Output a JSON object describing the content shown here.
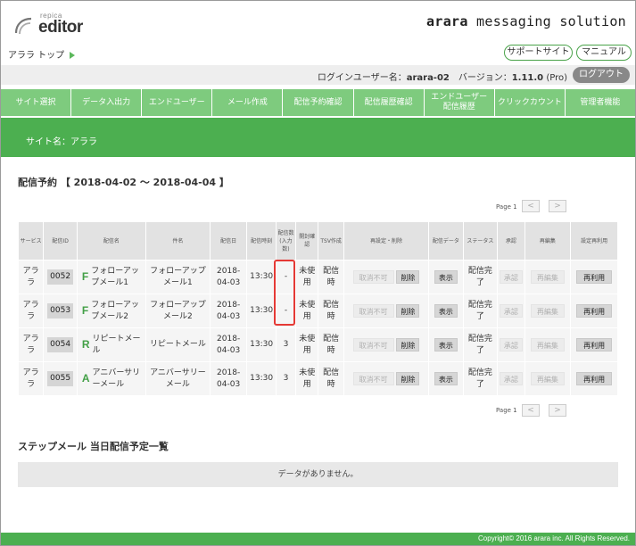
{
  "logo": {
    "small": "repica",
    "main": "editor"
  },
  "brand": {
    "left": "arara",
    "right": " messaging solution"
  },
  "breadcrumb": {
    "label": "アララ トップ"
  },
  "header_buttons": {
    "support": "サポートサイト",
    "manual": "マニュアル"
  },
  "userbar": {
    "user_label": "ログインユーザー名：",
    "user_name": "arara-02",
    "version_label": "　バージョン：",
    "version": "1.11.0",
    "edition": " (Pro)",
    "logout": "ログアウト"
  },
  "nav": {
    "items": [
      "サイト選択",
      "データ入出力",
      "エンドユーザー",
      "メール作成",
      "配信予約確認",
      "配信履歴確認",
      "エンドユーザー\n配信履歴",
      "クリックカウント",
      "管理者機能"
    ]
  },
  "site": {
    "label": "サイト名：アララ"
  },
  "schedule": {
    "title": "配信予約 【 2018-04-02 ～ 2018-04-04 】",
    "page_label": "Page 1",
    "prev": "<",
    "next": ">",
    "headers": [
      "サービス",
      "配信ID",
      "配信名",
      "件名",
      "配信日",
      "配信時刻",
      "配信数(入力数)",
      "開封確認",
      "TSV作成",
      "再設定・削除",
      "配信データ",
      "ステータス",
      "承認",
      "再編集",
      "設定再利用"
    ],
    "rows": [
      {
        "service": "アララ",
        "id": "0052",
        "letter": "F",
        "name": "フォローアップメール1",
        "subject": "フォローアップメール1",
        "date": "2018-04-03",
        "time": "13:30",
        "count": "-",
        "open": "未使用",
        "tsv": "配信時",
        "cancel": "取消不可",
        "delete": "削除",
        "show": "表示",
        "status": "配信完了",
        "approve": "承認",
        "reedit": "再編集",
        "reuse": "再利用"
      },
      {
        "service": "アララ",
        "id": "0053",
        "letter": "F",
        "name": "フォローアップメール2",
        "subject": "フォローアップメール2",
        "date": "2018-04-03",
        "time": "13:30",
        "count": "-",
        "open": "未使用",
        "tsv": "配信時",
        "cancel": "取消不可",
        "delete": "削除",
        "show": "表示",
        "status": "配信完了",
        "approve": "承認",
        "reedit": "再編集",
        "reuse": "再利用"
      },
      {
        "service": "アララ",
        "id": "0054",
        "letter": "R",
        "name": "リピートメール",
        "subject": "リピートメール",
        "date": "2018-04-03",
        "time": "13:30",
        "count": "3",
        "open": "未使用",
        "tsv": "配信時",
        "cancel": "取消不可",
        "delete": "削除",
        "show": "表示",
        "status": "配信完了",
        "approve": "承認",
        "reedit": "再編集",
        "reuse": "再利用"
      },
      {
        "service": "アララ",
        "id": "0055",
        "letter": "A",
        "name": "アニバーサリーメール",
        "subject": "アニバーサリーメール",
        "date": "2018-04-03",
        "time": "13:30",
        "count": "3",
        "open": "未使用",
        "tsv": "配信時",
        "cancel": "取消不可",
        "delete": "削除",
        "show": "表示",
        "status": "配信完了",
        "approve": "承認",
        "reedit": "再編集",
        "reuse": "再利用"
      }
    ]
  },
  "step": {
    "title": "ステップメール 当日配信予定一覧",
    "empty": "データがありません。"
  },
  "footer": {
    "copyright": "Copyright© 2016 arara inc. All Rights Reserved."
  },
  "colors": {
    "nav": "#7ecb7e",
    "site_bar": "#4caf50",
    "footer": "#4caf50",
    "highlight": "#e53935"
  }
}
